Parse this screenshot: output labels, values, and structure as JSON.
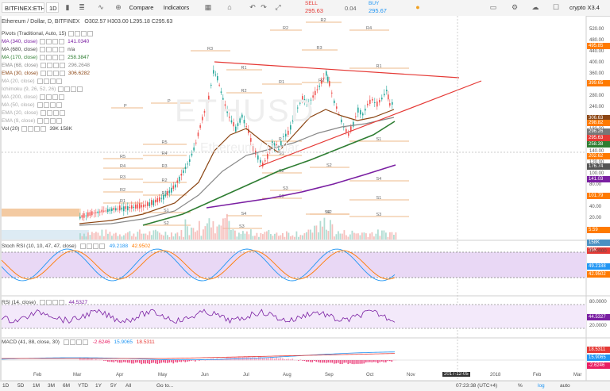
{
  "toolbar": {
    "symbol": "BITFINEX:ETHU",
    "interval": "1D",
    "compare": "Compare",
    "indicators": "Indicators",
    "sell_label": "SELL",
    "sell_price": "295.63",
    "spread": "0.04",
    "buy_label": "BUY",
    "buy_price": "295.67",
    "layout_name": "crypto X3.4"
  },
  "header": {
    "title": "Ethereum / Dollar, D, BITFINEX",
    "ohlc": "O302.57 H303.00 L295.18 C295.63"
  },
  "legend": [
    {
      "name": "Pivots (Traditional, Auto, 15)",
      "value": "",
      "color": "#444"
    },
    {
      "name": "MA (340, close)",
      "value": "141.0340",
      "color": "#7a1fa2"
    },
    {
      "name": "MA (680, close)",
      "value": "n/a",
      "color": "#444"
    },
    {
      "name": "MA (170, close)",
      "value": "258.3847",
      "color": "#2e7d32"
    },
    {
      "name": "EMA (68, close)",
      "value": "296.2648",
      "color": "#888"
    },
    {
      "name": "EMA (30, close)",
      "value": "306.6282",
      "color": "#8b4513"
    },
    {
      "name": "MA (20, close)",
      "value": "",
      "color": "#aaa"
    },
    {
      "name": "Ichimoku (9, 26, 52, 26)",
      "value": "",
      "color": "#aaa"
    },
    {
      "name": "MA (200, close)",
      "value": "",
      "color": "#aaa"
    },
    {
      "name": "MA (50, close)",
      "value": "",
      "color": "#aaa"
    },
    {
      "name": "EMA (20, close)",
      "value": "",
      "color": "#aaa"
    },
    {
      "name": "EMA (9, close)",
      "value": "",
      "color": "#aaa"
    },
    {
      "name": "Vol (20)",
      "value": "39K  158K",
      "color": "#444"
    }
  ],
  "watermark": {
    "symbol": "ETHUSD",
    "name": "Ethereum / Dollar"
  },
  "price_axis": {
    "ticks": [
      "520.00",
      "480.00",
      "440.00",
      "400.00",
      "360.00",
      "320.00",
      "280.00",
      "240.00",
      "200.00",
      "180.00",
      "160.00",
      "140.00",
      "120.00",
      "100.00",
      "80.00",
      "60.00",
      "40.00",
      "20.00"
    ],
    "tags": [
      {
        "text": "495.85",
        "color": "#ff7a00"
      },
      {
        "text": "399.65",
        "color": "#ff7a00"
      },
      {
        "text": "306.63",
        "color": "#8b4513"
      },
      {
        "text": "298.82",
        "color": "#ff7a00"
      },
      {
        "text": "296.26",
        "color": "#777777"
      },
      {
        "text": "295.63",
        "color": "#e53935"
      },
      {
        "text": "258.38",
        "color": "#2e7d32"
      },
      {
        "text": "202.62",
        "color": "#ff7a00"
      },
      {
        "text": "176.74",
        "color": "#555555"
      },
      {
        "text": "141.03",
        "color": "#7a1fa2"
      },
      {
        "text": "101.79",
        "color": "#ff7a00"
      },
      {
        "text": "5.59",
        "color": "#ff7a00"
      },
      {
        "text": "158K",
        "color": "#4a90c2"
      },
      {
        "text": "39K",
        "color": "#e53935"
      }
    ]
  },
  "pivot_labels": [
    "R2",
    "R4",
    "R2",
    "R3",
    "R1",
    "R3",
    "R1",
    "R2",
    "R1",
    "R2",
    "P",
    "P",
    "S1",
    "S2",
    "S3",
    "S4",
    "R5",
    "R4",
    "R3",
    "R2",
    "R1",
    "R5",
    "R4",
    "R3",
    "R2",
    "R1",
    "S1",
    "S2",
    "S3",
    "S4",
    "P",
    "S1",
    "S2",
    "S3",
    "S4",
    "S1",
    "S2",
    "S3"
  ],
  "stoch": {
    "label": "Stoch RSI (10, 10, 47, 47, close)",
    "value_k": "49.2188",
    "value_d": "42.9502",
    "ticks": [
      "80.0000",
      "20.0000"
    ],
    "tags": [
      {
        "text": "49.2188",
        "color": "#2196f3"
      },
      {
        "text": "42.9502",
        "color": "#ff7a00"
      }
    ]
  },
  "rsi": {
    "label": "RSI (14, close)",
    "value": "44.5327",
    "ticks": [
      "80.0000",
      "20.0000"
    ],
    "tag": "44.5327"
  },
  "macd": {
    "label": "MACD (41, 88, close, 30)",
    "values": [
      "-2.6246",
      "15.9065",
      "18.5311"
    ],
    "tags": [
      {
        "text": "18.5311",
        "color": "#e53935"
      },
      {
        "text": "15.9065",
        "color": "#2196f3"
      },
      {
        "text": "-2.6246",
        "color": "#e91e63"
      }
    ]
  },
  "time_axis": {
    "labels": [
      "Feb",
      "Mar",
      "Apr",
      "May",
      "Jun",
      "Jul",
      "Aug",
      "Sep",
      "Oct",
      "Nov",
      "2018",
      "Feb",
      "Mar"
    ],
    "crosshair_date": "2017-12-05"
  },
  "bottom_bar": {
    "ranges": [
      "1D",
      "5D",
      "1M",
      "3M",
      "6M",
      "YTD",
      "1Y",
      "5Y",
      "All"
    ],
    "goto": "Go to...",
    "clock": "07:23:38 (UTC+4)",
    "toggles": [
      "%",
      "log",
      "auto"
    ]
  },
  "colors": {
    "up": "#26a69a",
    "down": "#ef5350",
    "trendline": "#e53935",
    "ma170": "#2e7d32",
    "ma340": "#7a1fa2",
    "ema30": "#8b4513",
    "ema68": "#888888",
    "pivot": "#e8a060",
    "stoch_k": "#2196f3",
    "stoch_d": "#ff7a00"
  }
}
